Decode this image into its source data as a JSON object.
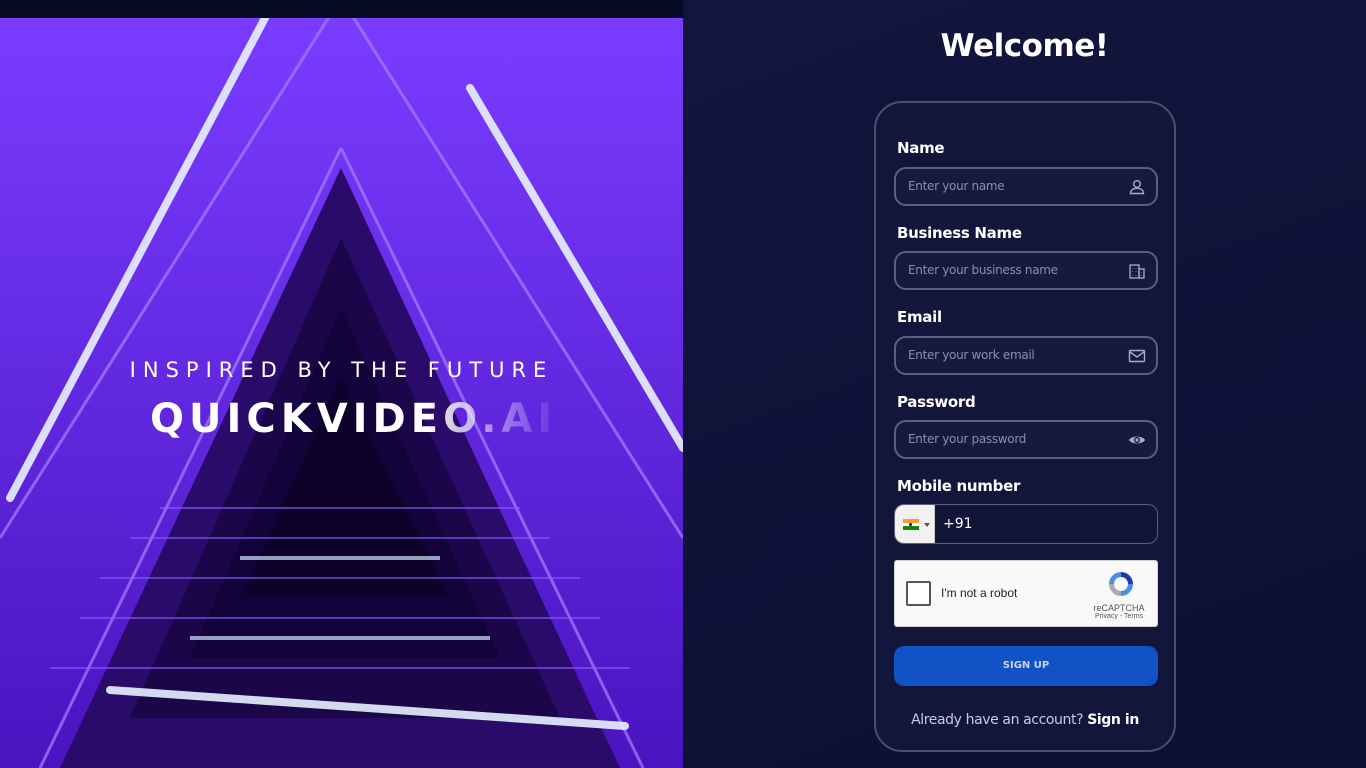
{
  "hero": {
    "tagline": "INSPIRED BY THE FUTURE",
    "brand": "QUICKVIDEO.AI",
    "image": "neon purple triangular stairwell"
  },
  "form": {
    "title": "Welcome!",
    "fields": {
      "name": {
        "label": "Name",
        "placeholder": "Enter your name",
        "icon": "user-icon"
      },
      "business": {
        "label": "Business Name",
        "placeholder": "Enter your business name",
        "icon": "building-icon"
      },
      "email": {
        "label": "Email",
        "placeholder": "Enter your work email",
        "icon": "mail-icon"
      },
      "password": {
        "label": "Password",
        "placeholder": "Enter your password",
        "icon": "eye-icon"
      },
      "mobile": {
        "label": "Mobile number",
        "country_code": "+91",
        "flag": "india-flag-icon"
      }
    },
    "captcha": {
      "label": "I'm not a robot",
      "brand": "reCAPTCHA",
      "links": "Privacy - Terms"
    },
    "submit_label": "SIGN UP",
    "footer": {
      "text": "Already have an account?",
      "link": "Sign in"
    }
  },
  "colors": {
    "background": "#0e1136",
    "card_border": "#4a4f72",
    "button": "#1153c6",
    "hero_accent": "#6a2cf0"
  }
}
